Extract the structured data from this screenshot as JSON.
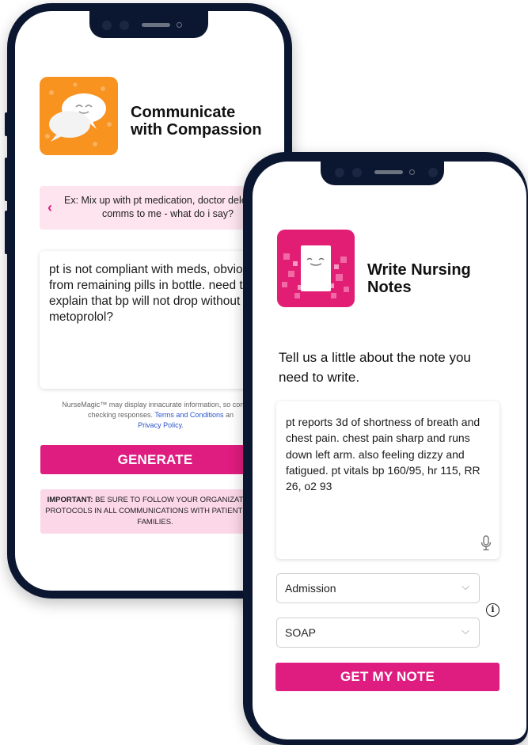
{
  "left_phone": {
    "title_line1": "Communicate",
    "title_line2": "with Compassion",
    "example_text": "Ex: Mix up with pt medication, doctor delegated comms to me - what do i say?",
    "input_text": "pt is not compliant with meds, obviou from remaining pills in bottle. need to explain that bp will not drop without metoprolol?",
    "disclaimer_pre": "NurseMagic™ may display innacurate information, so consider checking responses. ",
    "terms_link": "Terms and Conditions",
    "disclaimer_mid": " an",
    "privacy_link": "Privacy Policy",
    "disclaimer_end": ".",
    "generate_label": "GENERATE",
    "important_bold": "IMPORTANT:",
    "important_text": " BE SURE TO FOLLOW YOUR ORGANIZATION'S PROTOCOLS IN ALL COMMUNICATIONS WITH PATIENTS AND FAMILIES.",
    "icon_color": "#f7931e"
  },
  "right_phone": {
    "title_line1": "Write Nursing",
    "title_line2": "Notes",
    "prompt": "Tell us a little about the note you need to write.",
    "input_text": "pt reports 3d of shortness of breath and chest pain. chest pain sharp and runs down left arm. also feeling dizzy and fatigued. pt vitals bp 160/95, hr 115, RR 26, o2 93",
    "select_type": "Admission",
    "select_format": "SOAP",
    "button_label": "GET MY NOTE",
    "icon_color": "#e11d74"
  },
  "colors": {
    "accent": "#df1c7f",
    "phone_frame": "#0b1630"
  }
}
